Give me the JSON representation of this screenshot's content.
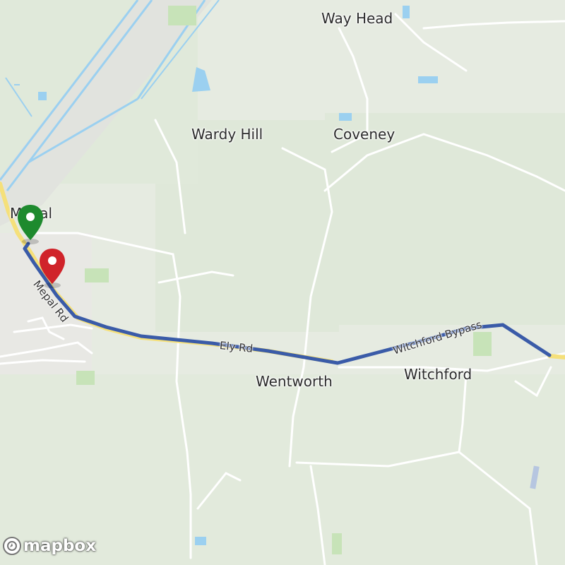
{
  "map": {
    "places": [
      {
        "key": "way-head",
        "label": "Way Head"
      },
      {
        "key": "wardy-hill",
        "label": "Wardy Hill"
      },
      {
        "key": "coveney",
        "label": "Coveney"
      },
      {
        "key": "mepal",
        "label": "Mepal"
      },
      {
        "key": "wentworth",
        "label": "Wentworth"
      },
      {
        "key": "witchford",
        "label": "Witchford"
      }
    ],
    "roads": [
      {
        "key": "mepal-rd",
        "label": "Mepal Rd"
      },
      {
        "key": "ely-rd",
        "label": "Ely Rd"
      },
      {
        "key": "witchford-bypass",
        "label": "Witchford Bypass"
      }
    ],
    "route_color": "#3a5ba8",
    "start_marker_color": "#1e8a2e",
    "end_marker_color": "#d0232a",
    "attribution": "mapbox"
  }
}
